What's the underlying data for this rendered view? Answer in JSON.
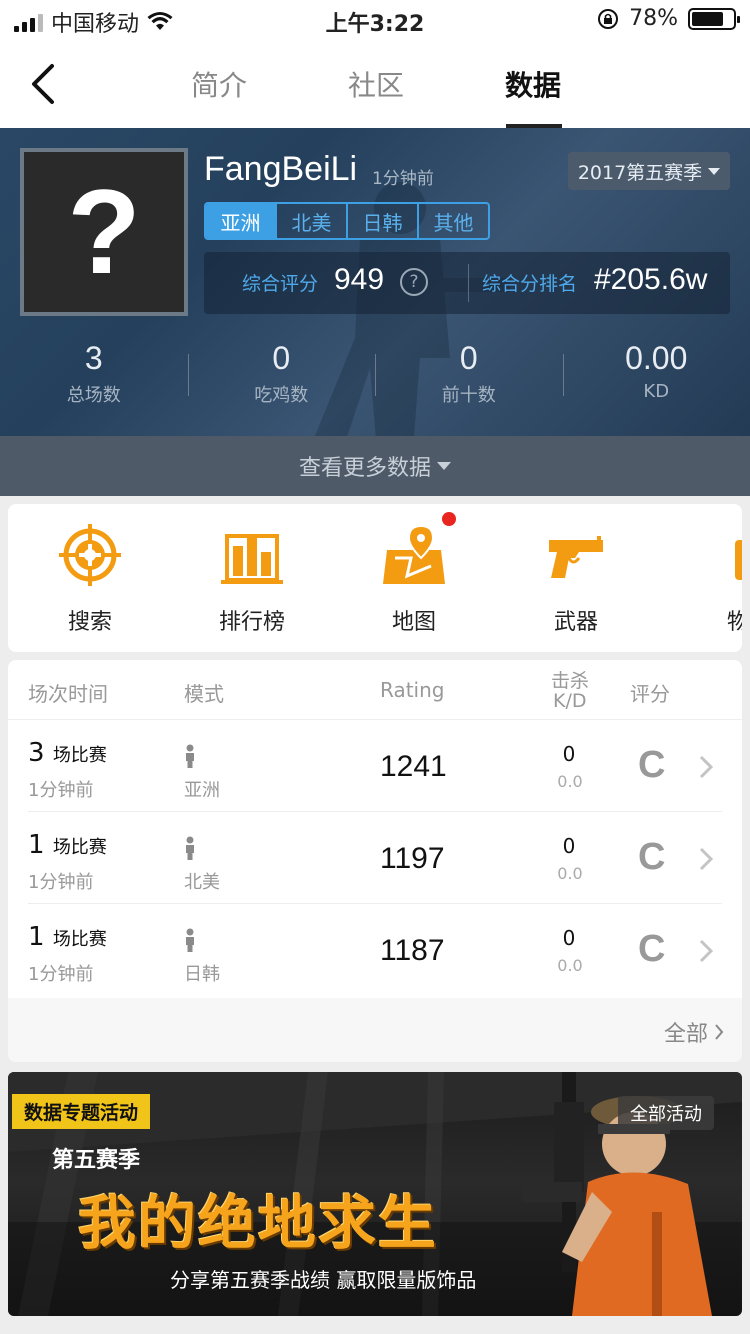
{
  "status_bar": {
    "carrier": "中国移动",
    "time": "上午3:22",
    "battery": "78%",
    "battery_level": 0.78
  },
  "nav": {
    "tabs": [
      "简介",
      "社区",
      "数据"
    ],
    "active_tab": "数据"
  },
  "profile": {
    "name": "FangBeiLi",
    "updated": "1分钟前",
    "avatar_placeholder": "?",
    "season": "2017第五赛季",
    "regions": [
      "亚洲",
      "北美",
      "日韩",
      "其他"
    ],
    "active_region": "亚洲",
    "rating_label": "综合评分",
    "rating_value": "949",
    "help": "?",
    "rank_label": "综合分排名",
    "rank_value": "#205.6w",
    "stats": [
      {
        "value": "3",
        "label": "总场数"
      },
      {
        "value": "0",
        "label": "吃鸡数"
      },
      {
        "value": "0",
        "label": "前十数"
      },
      {
        "value": "0.00",
        "label": "KD"
      }
    ],
    "more_label": "查看更多数据"
  },
  "menu": [
    {
      "label": "搜索",
      "icon": "crosshair-icon"
    },
    {
      "label": "排行榜",
      "icon": "leaderboard-icon"
    },
    {
      "label": "地图",
      "icon": "map-icon"
    },
    {
      "label": "武器",
      "icon": "pistol-icon"
    },
    {
      "label": "物",
      "icon": "item-icon"
    }
  ],
  "matches": {
    "headers": {
      "time": "场次时间",
      "mode": "模式",
      "rating": "Rating",
      "kills": "击杀",
      "kd": "K/D",
      "grade": "评分"
    },
    "rows": [
      {
        "count": "3",
        "unit": "场比赛",
        "ago": "1分钟前",
        "region": "亚洲",
        "rating": "1241",
        "kills": "0",
        "kd": "0.0",
        "grade": "C"
      },
      {
        "count": "1",
        "unit": "场比赛",
        "ago": "1分钟前",
        "region": "北美",
        "rating": "1197",
        "kills": "0",
        "kd": "0.0",
        "grade": "C"
      },
      {
        "count": "1",
        "unit": "场比赛",
        "ago": "1分钟前",
        "region": "日韩",
        "rating": "1187",
        "kills": "0",
        "kd": "0.0",
        "grade": "C"
      }
    ],
    "all_label": "全部"
  },
  "banner": {
    "tag": "数据专题活动",
    "all_activities": "全部活动",
    "season": "第五赛季",
    "title": "我的绝地求生",
    "subtitle": "分享第五赛季战绩 赢取限量版饰品"
  },
  "colors": {
    "accent_blue": "#3da0e4",
    "accent_orange": "#f39c12",
    "notify_red": "#e8261f",
    "banner_yellow": "#f0c419"
  }
}
